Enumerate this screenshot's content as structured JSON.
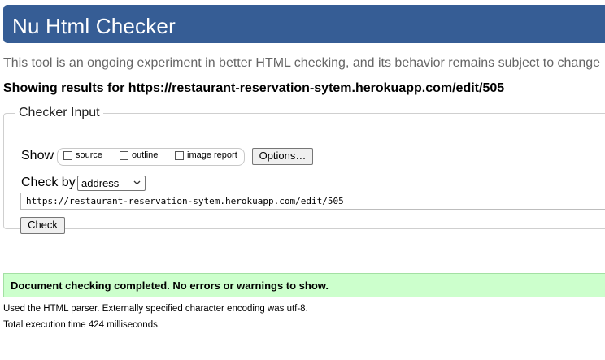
{
  "header": {
    "title": "Nu Html Checker"
  },
  "tagline": "This tool is an ongoing experiment in better HTML checking, and its behavior remains subject to change",
  "results_heading": "Showing results for https://restaurant-reservation-sytem.herokuapp.com/edit/505",
  "checker_input": {
    "legend": "Checker Input",
    "show_label": "Show",
    "show_options": [
      {
        "label": "source",
        "checked": false
      },
      {
        "label": "outline",
        "checked": false
      },
      {
        "label": "image report",
        "checked": false
      }
    ],
    "options_button": "Options…",
    "check_by_label": "Check by",
    "check_by_selected": "address",
    "url_value": "https://restaurant-reservation-sytem.herokuapp.com/edit/505",
    "check_button": "Check"
  },
  "result": {
    "success_message": "Document checking completed. No errors or warnings to show.",
    "parser_info": "Used the HTML parser. Externally specified character encoding was utf-8.",
    "execution_time": "Total execution time 424 milliseconds."
  },
  "colors": {
    "header_bg": "#365d95",
    "success_bg": "#ccffcc"
  }
}
